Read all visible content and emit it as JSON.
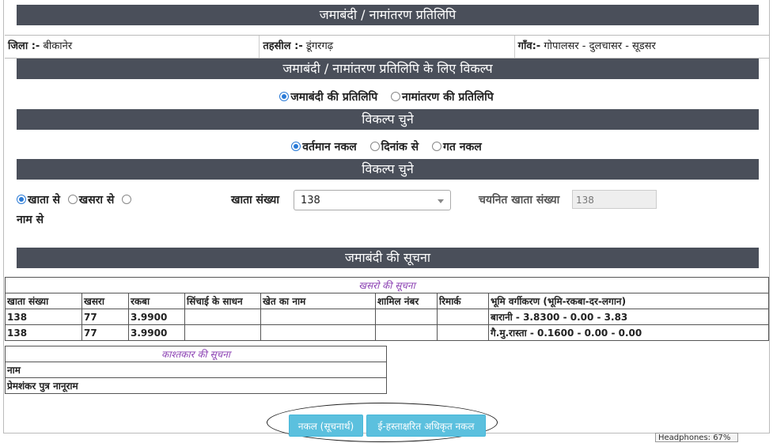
{
  "header": {
    "title": "जमाबंदी / नामांतरण प्रतिलिपि"
  },
  "location": {
    "district_label": "जिला :-",
    "district_value": "बीकानेर",
    "tehsil_label": "तहसील :-",
    "tehsil_value": "डूंगरगढ़",
    "village_label": "गाँव:-",
    "village_value": "गोपालसर - दुलचासर - सूडसर"
  },
  "copy_options": {
    "title": "जमाबंदी / नामांतरण प्रतिलिपि के लिए विकल्प",
    "opt1": "जमाबंदी की प्रतिलिपि",
    "opt2": "नामांतरण की प्रतिलिपि"
  },
  "choose1": {
    "title": "विकल्प चुने",
    "opt1": "वर्तमान नकल",
    "opt2": "दिनांक से",
    "opt3": "गत नकल"
  },
  "choose2": {
    "title": "विकल्प चुने",
    "opt1": "खाता से",
    "opt2": "खसरा से",
    "opt3": "नाम से",
    "khata_label": "खाता संख्या",
    "khata_value": "138",
    "selected_label": "चयनित खाता संख्या",
    "selected_value": "138"
  },
  "info": {
    "title": "जमाबंदी की सूचना"
  },
  "khasra_table": {
    "caption": "खसरो की सूचना",
    "headers": [
      "खाता संख्या",
      "खसरा",
      "रकबा",
      "सिंचाई के साधन",
      "खेत का नाम",
      "शामिल नंबर",
      "रिमार्क",
      "भूमि वर्गीकरण (भूमि-रकबा-दर-लगान)"
    ],
    "rows": [
      [
        "138",
        "77",
        "3.9900",
        "",
        "",
        "",
        "",
        "बारानी - 3.8300 - 0.00 - 3.83"
      ],
      [
        "138",
        "77",
        "3.9900",
        "",
        "",
        "",
        "",
        "गै.मु.रास्ता - 0.1600 - 0.00 - 0.00"
      ]
    ]
  },
  "farmer_table": {
    "caption": "काश्तकार की सूचना",
    "header": "नाम",
    "row": "प्रेमशंकर पुत्र नानूराम"
  },
  "buttons": {
    "copy": "नकल (सूचनार्थ)",
    "esign": "ई-हस्ताक्षरित अधिकृत नकल"
  },
  "tooltip": "Headphones: 67%"
}
